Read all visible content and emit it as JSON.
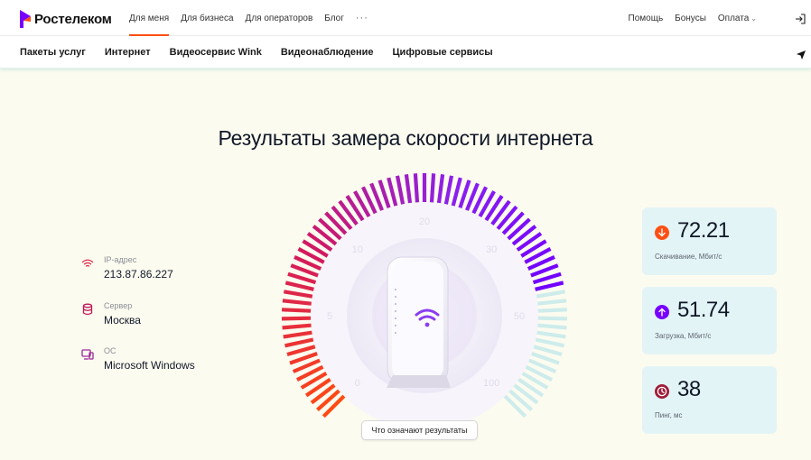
{
  "brand": {
    "name": "Ростелеком",
    "accent": "#ff4f12",
    "purple": "#7700ff"
  },
  "topnav": {
    "items": [
      {
        "label": "Для меня",
        "active": true
      },
      {
        "label": "Для бизнеса",
        "active": false
      },
      {
        "label": "Для операторов",
        "active": false
      },
      {
        "label": "Блог",
        "active": false
      }
    ],
    "more": "···",
    "right": [
      {
        "label": "Помощь"
      },
      {
        "label": "Бонусы"
      },
      {
        "label": "Оплата",
        "dropdown": true
      }
    ],
    "login_icon": "login-icon"
  },
  "subnav": {
    "items": [
      {
        "label": "Пакеты услуг"
      },
      {
        "label": "Интернет"
      },
      {
        "label": "Видеосервис Wink"
      },
      {
        "label": "Видеонаблюдение"
      },
      {
        "label": "Цифровые сервисы"
      }
    ],
    "location_icon": "location-arrow-icon"
  },
  "page_title": "Результаты замера скорости интернета",
  "info": {
    "ip": {
      "label": "IP-адрес",
      "value": "213.87.86.227",
      "icon": "wifi-icon"
    },
    "server": {
      "label": "Сервер",
      "value": "Москва",
      "icon": "database-icon"
    },
    "os": {
      "label": "ОС",
      "value": "Microsoft Windows",
      "icon": "devices-icon"
    }
  },
  "gauge": {
    "scale_labels": [
      "0",
      "5",
      "10",
      "20",
      "30",
      "50",
      "100"
    ],
    "active_fraction": 0.79,
    "center_icon": "wifi-router-icon"
  },
  "results_button": "Что означают результаты",
  "results": {
    "download": {
      "value": "72.21",
      "label": "Скачивание, Мбит/с",
      "icon": "arrow-down-icon",
      "color": "#ff4f12"
    },
    "upload": {
      "value": "51.74",
      "label": "Загрузка, Мбит/с",
      "icon": "arrow-up-icon",
      "color": "#7700ff"
    },
    "ping": {
      "value": "38",
      "label": "Пинг, мс",
      "icon": "clock-icon",
      "color": "#a01c3a"
    }
  }
}
